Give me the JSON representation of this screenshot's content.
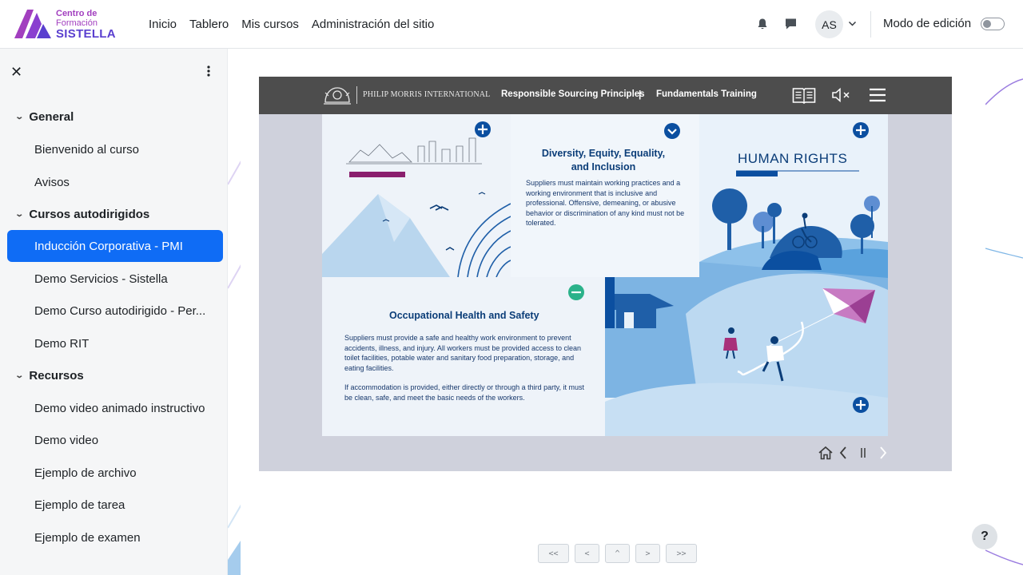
{
  "brand": {
    "line1": "Centro de",
    "line2": "Formación",
    "line3": "SISTELLA",
    "accent": "#a23fbf",
    "primary": "#0f6cf5"
  },
  "nav": {
    "links": [
      "Inicio",
      "Tablero",
      "Mis cursos",
      "Administración del sitio"
    ]
  },
  "user": {
    "initials": "AS",
    "edit_mode_label": "Modo de edición"
  },
  "icons": {
    "notifications": "bell-icon",
    "messages": "chat-icon",
    "close": "close-icon",
    "more": "kebab-icon",
    "help": "?"
  },
  "sidebar": {
    "sections": [
      {
        "title": "General",
        "items": [
          "Bienvenido al curso",
          "Avisos"
        ]
      },
      {
        "title": "Cursos autodirigidos",
        "items": [
          "Inducción Corporativa - PMI",
          "Demo Servicios - Sistella",
          "Demo Curso autodirigido - Per...",
          "Demo RIT"
        ]
      },
      {
        "title": "Recursos",
        "items": [
          "Demo video animado instructivo",
          "Demo video",
          "Ejemplo de archivo",
          "Ejemplo de tarea",
          "Ejemplo de examen"
        ]
      }
    ],
    "active_item": "Inducción Corporativa - PMI"
  },
  "player": {
    "company": "PHILIP MORRIS INTERNATIONAL",
    "title": "Responsible Sourcing Principles",
    "separator": "|",
    "subtitle": "Fundamentals Training",
    "slide": {
      "dei_title": "Diversity, Equity, Equality, and Inclusion",
      "dei_body": "Suppliers must maintain working practices and a working environment that is inclusive and professional. Offensive, demeaning, or abusive behavior or discrimination of any kind must not be tolerated.",
      "hr_title": "HUMAN RIGHTS",
      "ohs_title": "Occupational Health and Safety",
      "ohs_body": "Suppliers must provide a safe and healthy work environment to prevent accidents, illness, and injury. All workers must be provided access to clean toilet facilities, potable water and sanitary food preparation, storage, and eating facilities.",
      "ohs_body2": "If accommodation is provided, either directly or through a third party, it must be clean, safe, and meet the basic needs of the workers."
    }
  },
  "pager": [
    "<<",
    "<",
    "^",
    ">",
    ">>"
  ]
}
